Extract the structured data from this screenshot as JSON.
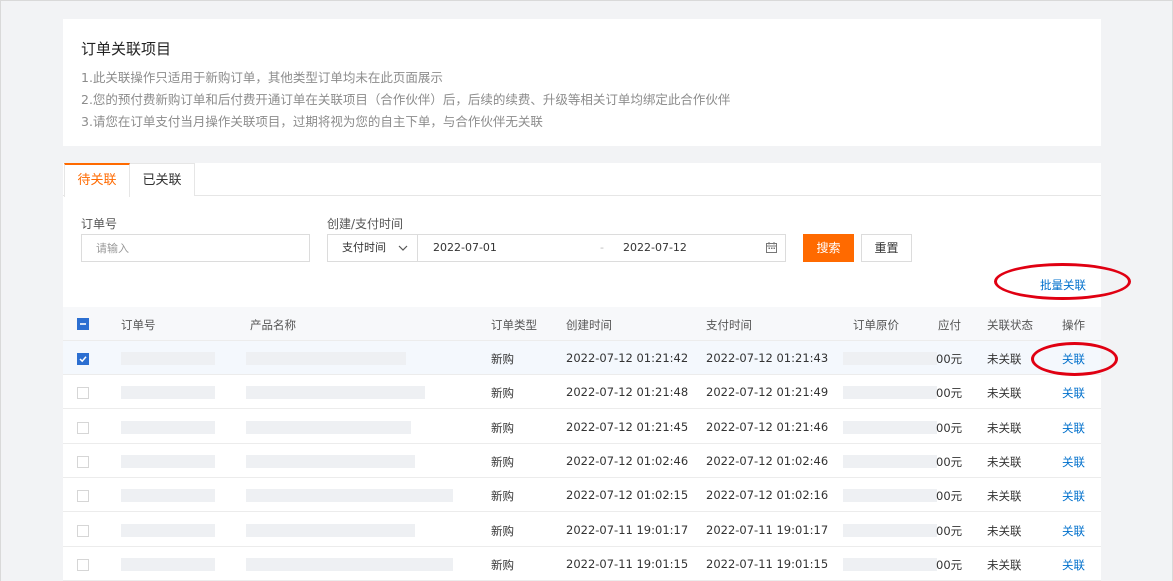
{
  "notice": {
    "title": "订单关联项目",
    "lines": [
      "1.此关联操作只适用于新购订单，其他类型订单均未在此页面展示",
      "2.您的预付费新购订单和后付费开通订单在关联项目（合作伙伴）后，后续的续费、升级等相关订单均绑定此合作伙伴",
      "3.请您在订单支付当月操作关联项目，过期将视为您的自主下单，与合作伙伴无关联"
    ]
  },
  "tabs": [
    {
      "label": "待关联",
      "active": true
    },
    {
      "label": "已关联",
      "active": false
    }
  ],
  "filters": {
    "order_label": "订单号",
    "order_placeholder": "请输入",
    "time_label": "创建/支付时间",
    "time_type": "支付时间",
    "start_date": "2022-07-01",
    "separator": "-",
    "end_date": "2022-07-12",
    "search_label": "搜索",
    "reset_label": "重置"
  },
  "batch_label": "批量关联",
  "accent_color": "#ff6a00",
  "link_color": "#0070cc",
  "highlight_color": "#e00012",
  "table": {
    "headers": {
      "order_no": "订单号",
      "product": "产品名称",
      "type": "订单类型",
      "created": "创建时间",
      "paid": "支付时间",
      "price": "订单原价",
      "payable": "应付",
      "status": "关联状态",
      "action": "操作"
    },
    "rows": [
      {
        "checked": true,
        "type": "新购",
        "created": "2022-07-12 01:21:42",
        "paid": "2022-07-12 01:21:43",
        "payable": "00元",
        "status": "未关联",
        "action": "关联"
      },
      {
        "checked": false,
        "type": "新购",
        "created": "2022-07-12 01:21:48",
        "paid": "2022-07-12 01:21:49",
        "payable": "00元",
        "status": "未关联",
        "action": "关联"
      },
      {
        "checked": false,
        "type": "新购",
        "created": "2022-07-12 01:21:45",
        "paid": "2022-07-12 01:21:46",
        "payable": "00元",
        "status": "未关联",
        "action": "关联"
      },
      {
        "checked": false,
        "type": "新购",
        "created": "2022-07-12 01:02:46",
        "paid": "2022-07-12 01:02:46",
        "payable": "00元",
        "status": "未关联",
        "action": "关联"
      },
      {
        "checked": false,
        "type": "新购",
        "created": "2022-07-12 01:02:15",
        "paid": "2022-07-12 01:02:16",
        "payable": "00元",
        "status": "未关联",
        "action": "关联"
      },
      {
        "checked": false,
        "type": "新购",
        "created": "2022-07-11 19:01:17",
        "paid": "2022-07-11 19:01:17",
        "payable": "00元",
        "status": "未关联",
        "action": "关联"
      },
      {
        "checked": false,
        "type": "新购",
        "created": "2022-07-11 19:01:15",
        "paid": "2022-07-11 19:01:15",
        "payable": "00元",
        "status": "未关联",
        "action": "关联"
      }
    ]
  }
}
